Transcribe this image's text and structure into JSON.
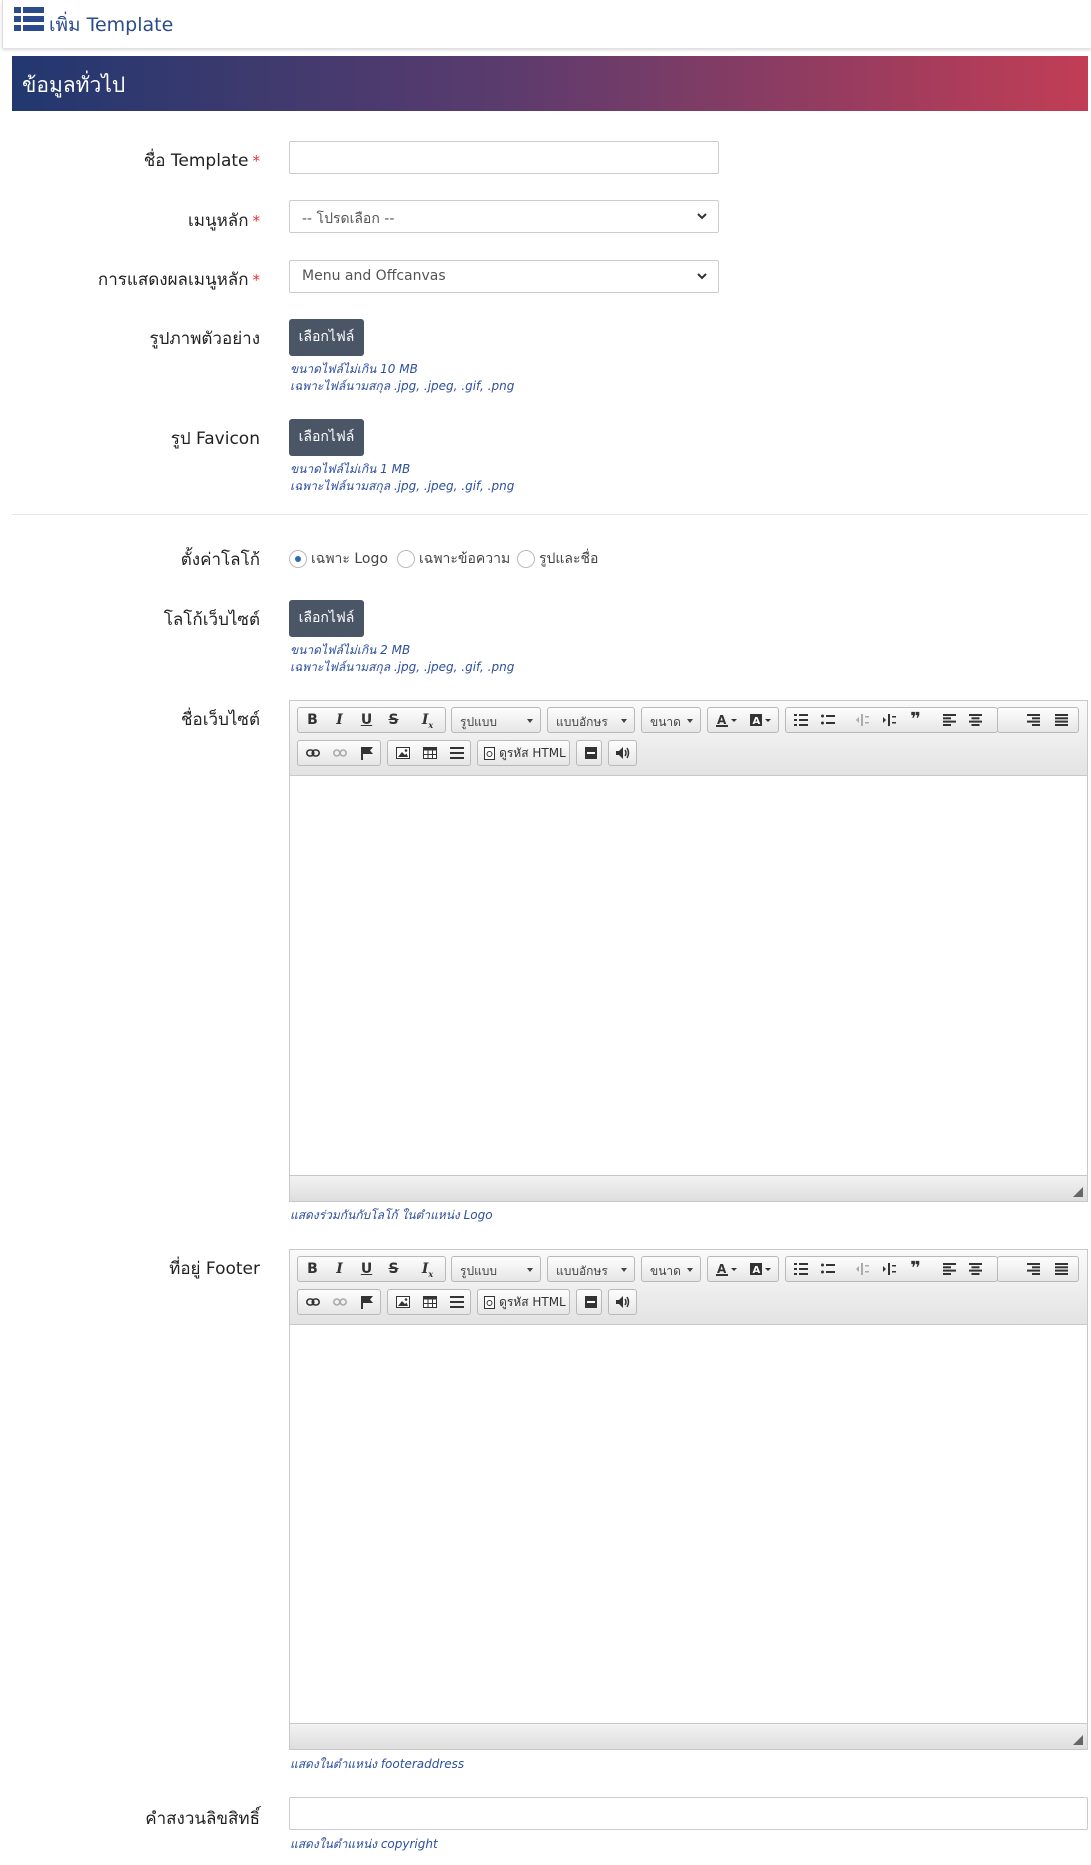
{
  "header": {
    "title": "เพิ่ม Template",
    "icon": "list-icon"
  },
  "section": {
    "title": "ข้อมูลทั่วไป"
  },
  "form": {
    "template_name": {
      "label": "ชื่อ Template",
      "required_mark": "*",
      "value": ""
    },
    "main_menu": {
      "label": "เมนูหลัก",
      "required_mark": "*",
      "selected": "-- โปรดเลือก --"
    },
    "main_menu_display": {
      "label": "การแสดงผลเมนูหลัก",
      "required_mark": "*",
      "selected": "Menu and Offcanvas"
    },
    "preview_image": {
      "label": "รูปภาพตัวอย่าง",
      "button": "เลือกไฟล์",
      "hint_size": "ขนาดไฟล์ไม่เกิน 10 MB",
      "hint_types": "เฉพาะไฟล์นามสกุล .jpg, .jpeg, .gif, .png"
    },
    "favicon": {
      "label": "รูป Favicon",
      "button": "เลือกไฟล์",
      "hint_size": "ขนาดไฟล์ไม่เกิน 1 MB",
      "hint_types": "เฉพาะไฟล์นามสกุล .jpg, .jpeg, .gif, .png"
    },
    "logo_setting": {
      "label": "ตั้งค่าโลโก้",
      "options": [
        {
          "label": "เฉพาะ Logo",
          "selected": true
        },
        {
          "label": "เฉพาะข้อความ",
          "selected": false
        },
        {
          "label": "รูปและชื่อ",
          "selected": false
        }
      ]
    },
    "website_logo": {
      "label": "โลโก้เว็บไซต์",
      "button": "เลือกไฟล์",
      "hint_size": "ขนาดไฟล์ไม่เกิน 2 MB",
      "hint_types": "เฉพาะไฟล์นามสกุล .jpg, .jpeg, .gif, .png"
    },
    "website_name": {
      "label": "ชื่อเว็บไซต์",
      "hint": "แสดงร่วมกันกับโลโก้ ในตำแหน่ง Logo"
    },
    "footer_address": {
      "label": "ที่อยู่ Footer",
      "hint": "แสดงในตำแหน่ง footeraddress"
    },
    "copyright": {
      "label": "คำสงวนลิขสิทธิ์",
      "value": "",
      "hint": "แสดงในตำแหน่ง copyright"
    }
  },
  "editor_toolbar": {
    "format_label": "รูปแบบ",
    "font_label": "แบบอักษร",
    "size_label": "ขนาด",
    "source_label": "ดูรหัส HTML"
  }
}
